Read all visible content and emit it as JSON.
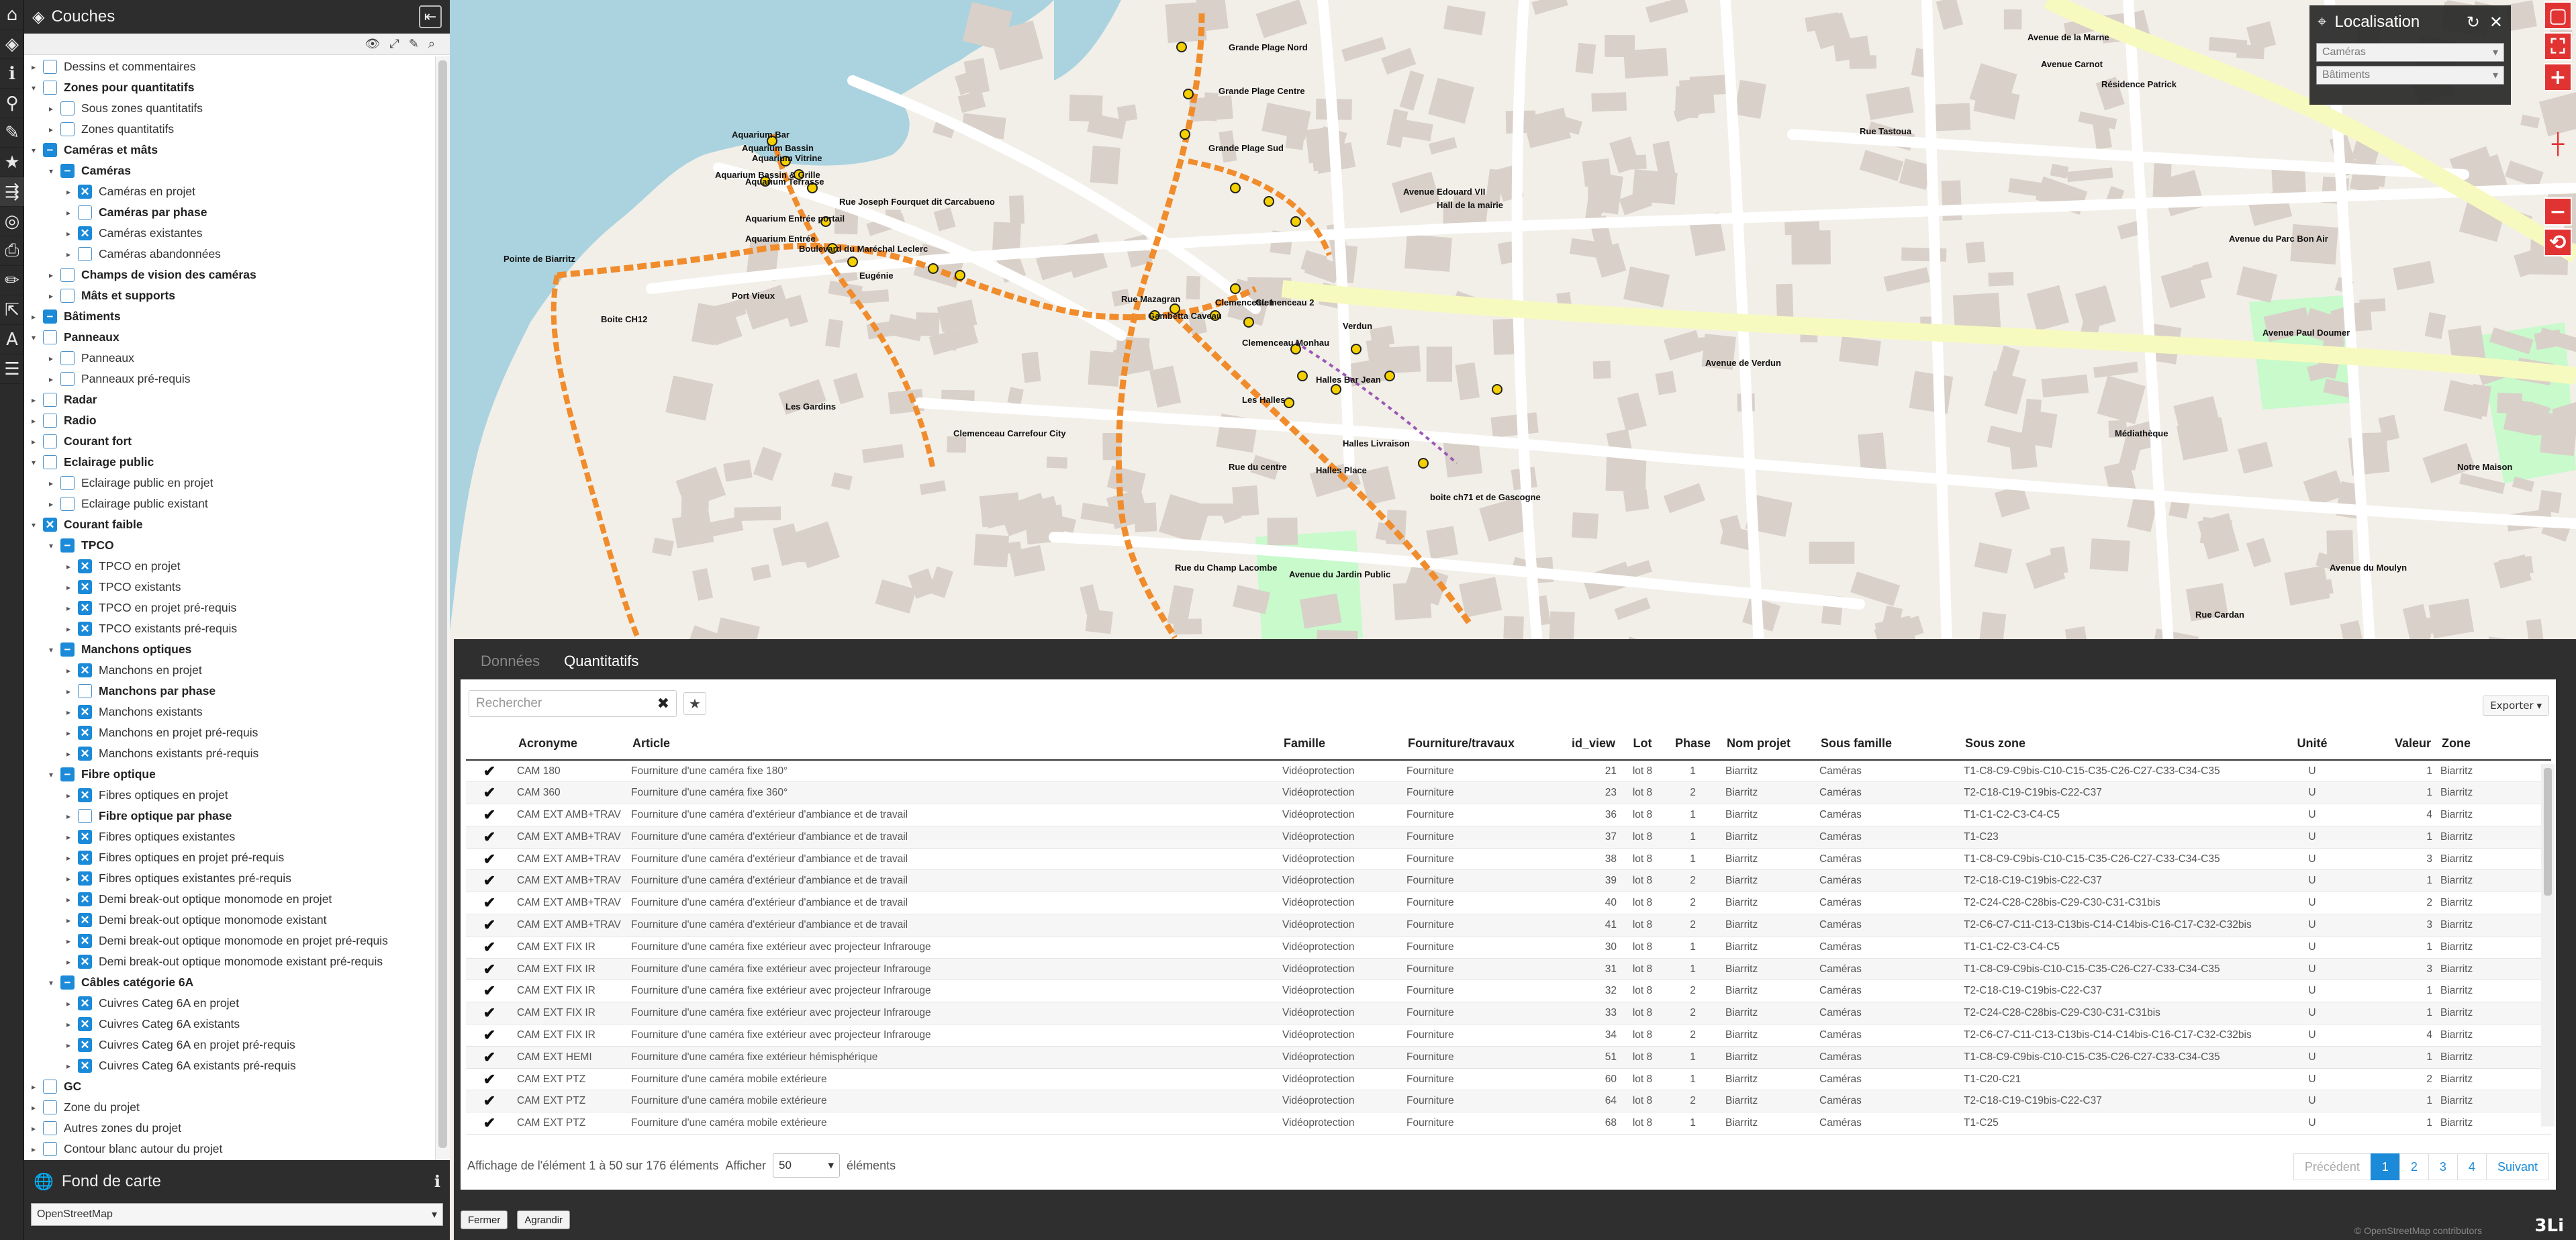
{
  "toolstrip": {
    "icons": [
      "layers-home-icon",
      "layers-icon",
      "info-icon",
      "measure-icon",
      "comment-icon",
      "favorite-star-icon",
      "road-icon",
      "target-icon",
      "print-icon",
      "draw-icon",
      "export-icon",
      "symbol-icon",
      "list-icon"
    ]
  },
  "layers_panel": {
    "title": "Couches",
    "items": [
      {
        "level": 0,
        "toggle": "▸",
        "check": "none",
        "label": "Dessins et commentaires",
        "bold": false
      },
      {
        "level": 0,
        "toggle": "▾",
        "check": "none",
        "label": "Zones pour quantitatifs",
        "bold": true
      },
      {
        "level": 1,
        "toggle": "▸",
        "check": "none",
        "label": "Sous zones quantitatifs",
        "bold": false
      },
      {
        "level": 1,
        "toggle": "▸",
        "check": "none",
        "label": "Zones quantitatifs",
        "bold": false
      },
      {
        "level": 0,
        "toggle": "▾",
        "check": "dash",
        "label": "Caméras et mâts",
        "bold": true
      },
      {
        "level": 1,
        "toggle": "▾",
        "check": "dash",
        "label": "Caméras",
        "bold": true
      },
      {
        "level": 2,
        "toggle": "▸",
        "check": "x",
        "label": "Caméras en projet",
        "bold": false
      },
      {
        "level": 2,
        "toggle": "▸",
        "check": "none",
        "label": "Caméras par phase",
        "bold": true
      },
      {
        "level": 2,
        "toggle": "▸",
        "check": "x",
        "label": "Caméras existantes",
        "bold": false
      },
      {
        "level": 2,
        "toggle": "▸",
        "check": "none",
        "label": "Caméras abandonnées",
        "bold": false
      },
      {
        "level": 1,
        "toggle": "▸",
        "check": "none",
        "label": "Champs de vision des caméras",
        "bold": true
      },
      {
        "level": 1,
        "toggle": "▸",
        "check": "none",
        "label": "Mâts et supports",
        "bold": true
      },
      {
        "level": 0,
        "toggle": "▸",
        "check": "dash",
        "label": "Bâtiments",
        "bold": true
      },
      {
        "level": 0,
        "toggle": "▾",
        "check": "none",
        "label": "Panneaux",
        "bold": true
      },
      {
        "level": 1,
        "toggle": "▸",
        "check": "none",
        "label": "Panneaux",
        "bold": false
      },
      {
        "level": 1,
        "toggle": "▸",
        "check": "none",
        "label": "Panneaux pré-requis",
        "bold": false
      },
      {
        "level": 0,
        "toggle": "▸",
        "check": "none",
        "label": "Radar",
        "bold": true
      },
      {
        "level": 0,
        "toggle": "▸",
        "check": "none",
        "label": "Radio",
        "bold": true
      },
      {
        "level": 0,
        "toggle": "▸",
        "check": "none",
        "label": "Courant fort",
        "bold": true
      },
      {
        "level": 0,
        "toggle": "▾",
        "check": "none",
        "label": "Eclairage public",
        "bold": true
      },
      {
        "level": 1,
        "toggle": "▸",
        "check": "none",
        "label": "Eclairage public en projet",
        "bold": false
      },
      {
        "level": 1,
        "toggle": "▸",
        "check": "none",
        "label": "Eclairage public existant",
        "bold": false
      },
      {
        "level": 0,
        "toggle": "▾",
        "check": "x",
        "label": "Courant faible",
        "bold": true
      },
      {
        "level": 1,
        "toggle": "▾",
        "check": "dash",
        "label": "TPCO",
        "bold": true
      },
      {
        "level": 2,
        "toggle": "▸",
        "check": "x",
        "label": "TPCO en projet",
        "bold": false
      },
      {
        "level": 2,
        "toggle": "▸",
        "check": "x",
        "label": "TPCO existants",
        "bold": false
      },
      {
        "level": 2,
        "toggle": "▸",
        "check": "x",
        "label": "TPCO en projet pré-requis",
        "bold": false
      },
      {
        "level": 2,
        "toggle": "▸",
        "check": "x",
        "label": "TPCO existants pré-requis",
        "bold": false
      },
      {
        "level": 1,
        "toggle": "▾",
        "check": "dash",
        "label": "Manchons optiques",
        "bold": true
      },
      {
        "level": 2,
        "toggle": "▸",
        "check": "x",
        "label": "Manchons en projet",
        "bold": false
      },
      {
        "level": 2,
        "toggle": "▸",
        "check": "none",
        "label": "Manchons par phase",
        "bold": true
      },
      {
        "level": 2,
        "toggle": "▸",
        "check": "x",
        "label": "Manchons existants",
        "bold": false
      },
      {
        "level": 2,
        "toggle": "▸",
        "check": "x",
        "label": "Manchons en projet pré-requis",
        "bold": false
      },
      {
        "level": 2,
        "toggle": "▸",
        "check": "x",
        "label": "Manchons existants pré-requis",
        "bold": false
      },
      {
        "level": 1,
        "toggle": "▾",
        "check": "dash",
        "label": "Fibre optique",
        "bold": true
      },
      {
        "level": 2,
        "toggle": "▸",
        "check": "x",
        "label": "Fibres optiques en projet",
        "bold": false
      },
      {
        "level": 2,
        "toggle": "▸",
        "check": "none",
        "label": "Fibre optique par phase",
        "bold": true
      },
      {
        "level": 2,
        "toggle": "▸",
        "check": "x",
        "label": "Fibres optiques existantes",
        "bold": false
      },
      {
        "level": 2,
        "toggle": "▸",
        "check": "x",
        "label": "Fibres optiques en projet pré-requis",
        "bold": false
      },
      {
        "level": 2,
        "toggle": "▸",
        "check": "x",
        "label": "Fibres optiques existantes pré-requis",
        "bold": false
      },
      {
        "level": 2,
        "toggle": "▸",
        "check": "x",
        "label": "Demi break-out optique monomode en projet",
        "bold": false
      },
      {
        "level": 2,
        "toggle": "▸",
        "check": "x",
        "label": "Demi break-out optique monomode existant",
        "bold": false
      },
      {
        "level": 2,
        "toggle": "▸",
        "check": "x",
        "label": "Demi break-out optique monomode en projet pré-requis",
        "bold": false
      },
      {
        "level": 2,
        "toggle": "▸",
        "check": "x",
        "label": "Demi break-out optique monomode existant pré-requis",
        "bold": false
      },
      {
        "level": 1,
        "toggle": "▾",
        "check": "dash",
        "label": "Câbles catégorie 6A",
        "bold": true
      },
      {
        "level": 2,
        "toggle": "▸",
        "check": "x",
        "label": "Cuivres Categ 6A en projet",
        "bold": false
      },
      {
        "level": 2,
        "toggle": "▸",
        "check": "x",
        "label": "Cuivres Categ 6A existants",
        "bold": false
      },
      {
        "level": 2,
        "toggle": "▸",
        "check": "x",
        "label": "Cuivres Categ 6A en projet pré-requis",
        "bold": false
      },
      {
        "level": 2,
        "toggle": "▸",
        "check": "x",
        "label": "Cuivres Categ 6A existants pré-requis",
        "bold": false
      },
      {
        "level": 0,
        "toggle": "▸",
        "check": "none",
        "label": "GC",
        "bold": true
      },
      {
        "level": 0,
        "toggle": "▸",
        "check": "none",
        "label": "Zone du projet",
        "bold": false
      },
      {
        "level": 0,
        "toggle": "▸",
        "check": "none",
        "label": "Autres zones du projet",
        "bold": false
      },
      {
        "level": 0,
        "toggle": "▸",
        "check": "none",
        "label": "Contour blanc autour du projet",
        "bold": false
      }
    ]
  },
  "basemap": {
    "title": "Fond de carte",
    "selected": "OpenStreetMap"
  },
  "localisation": {
    "title": "Localisation",
    "select1": "Caméras",
    "select2": "Bâtiments"
  },
  "map": {
    "labels": [
      "Grande Plage Nord",
      "Grande Plage Centre",
      "Grande Plage Sud",
      "Aquarium Bar",
      "Aquarium Bassin",
      "Aquarium Vitrine",
      "Aquarium Bassin & Grille",
      "Aquarium Terrasse",
      "Aquarium Entrée portail",
      "Aquarium Entrée",
      "Port Vieux",
      "Boite CH12",
      "Eugénie",
      "Gambetta Caveau",
      "Clemenceau 1",
      "Clemenceau 2",
      "Clemenceau Monhau",
      "Verdun",
      "Halles Bar Jean",
      "Les Halles",
      "Halles Livraison",
      "Halles Place",
      "Rue du centre",
      "Clemenceau Carrefour City",
      "Hall de la mairie",
      "Avenue de Verdun",
      "Avenue de la Marne",
      "Avenue Edouard VII",
      "Rue Mazagran",
      "Rue du Champ Lacombe",
      "Avenue du Jardin Public",
      "Avenue du Parc Bon Air",
      "Boulevard du Maréchal Leclerc",
      "Rue Joseph Fourquet dit Carcabueno",
      "Pointe de Biarritz",
      "Avenue Carnot",
      "Rue Cardan",
      "Avenue du Moulyn",
      "Rue Tastoua",
      "Avenue Paul Doumer",
      "Médiathèque",
      "Notre Maison",
      "Résidence Patrick",
      "Les Gardins",
      "boite ch71 et de Gascogne"
    ]
  },
  "panel": {
    "tabs": [
      {
        "label": "Données",
        "active": false
      },
      {
        "label": "Quantitatifs",
        "active": true
      }
    ],
    "search_placeholder": "Rechercher",
    "export_label": "Exporter",
    "columns": [
      "",
      "Acronyme",
      "Article",
      "Famille",
      "Fourniture/travaux",
      "id_view",
      "Lot",
      "Phase",
      "Nom projet",
      "Sous famille",
      "Sous zone",
      "Unité",
      "Valeur",
      "Zone"
    ],
    "rows": [
      [
        "✔",
        "CAM 180",
        "Fourniture d'une caméra fixe 180°",
        "Vidéoprotection",
        "Fourniture",
        "21",
        "lot 8",
        "1",
        "Biarritz",
        "Caméras",
        "T1-C8-C9-C9bis-C10-C15-C35-C26-C27-C33-C34-C35",
        "U",
        "1",
        "Biarritz"
      ],
      [
        "✔",
        "CAM 360",
        "Fourniture d'une caméra fixe 360°",
        "Vidéoprotection",
        "Fourniture",
        "23",
        "lot 8",
        "2",
        "Biarritz",
        "Caméras",
        "T2-C18-C19-C19bis-C22-C37",
        "U",
        "1",
        "Biarritz"
      ],
      [
        "✔",
        "CAM EXT AMB+TRAV",
        "Fourniture d'une caméra d'extérieur d'ambiance et de travail",
        "Vidéoprotection",
        "Fourniture",
        "36",
        "lot 8",
        "1",
        "Biarritz",
        "Caméras",
        "T1-C1-C2-C3-C4-C5",
        "U",
        "4",
        "Biarritz"
      ],
      [
        "✔",
        "CAM EXT AMB+TRAV",
        "Fourniture d'une caméra d'extérieur d'ambiance et de travail",
        "Vidéoprotection",
        "Fourniture",
        "37",
        "lot 8",
        "1",
        "Biarritz",
        "Caméras",
        "T1-C23",
        "U",
        "1",
        "Biarritz"
      ],
      [
        "✔",
        "CAM EXT AMB+TRAV",
        "Fourniture d'une caméra d'extérieur d'ambiance et de travail",
        "Vidéoprotection",
        "Fourniture",
        "38",
        "lot 8",
        "1",
        "Biarritz",
        "Caméras",
        "T1-C8-C9-C9bis-C10-C15-C35-C26-C27-C33-C34-C35",
        "U",
        "3",
        "Biarritz"
      ],
      [
        "✔",
        "CAM EXT AMB+TRAV",
        "Fourniture d'une caméra d'extérieur d'ambiance et de travail",
        "Vidéoprotection",
        "Fourniture",
        "39",
        "lot 8",
        "2",
        "Biarritz",
        "Caméras",
        "T2-C18-C19-C19bis-C22-C37",
        "U",
        "1",
        "Biarritz"
      ],
      [
        "✔",
        "CAM EXT AMB+TRAV",
        "Fourniture d'une caméra d'extérieur d'ambiance et de travail",
        "Vidéoprotection",
        "Fourniture",
        "40",
        "lot 8",
        "2",
        "Biarritz",
        "Caméras",
        "T2-C24-C28-C28bis-C29-C30-C31-C31bis",
        "U",
        "2",
        "Biarritz"
      ],
      [
        "✔",
        "CAM EXT AMB+TRAV",
        "Fourniture d'une caméra d'extérieur d'ambiance et de travail",
        "Vidéoprotection",
        "Fourniture",
        "41",
        "lot 8",
        "2",
        "Biarritz",
        "Caméras",
        "T2-C6-C7-C11-C13-C13bis-C14-C14bis-C16-C17-C32-C32bis",
        "U",
        "3",
        "Biarritz"
      ],
      [
        "✔",
        "CAM EXT FIX IR",
        "Fourniture d'une caméra fixe extérieur avec projecteur Infrarouge",
        "Vidéoprotection",
        "Fourniture",
        "30",
        "lot 8",
        "1",
        "Biarritz",
        "Caméras",
        "T1-C1-C2-C3-C4-C5",
        "U",
        "1",
        "Biarritz"
      ],
      [
        "✔",
        "CAM EXT FIX IR",
        "Fourniture d'une caméra fixe extérieur avec projecteur Infrarouge",
        "Vidéoprotection",
        "Fourniture",
        "31",
        "lot 8",
        "1",
        "Biarritz",
        "Caméras",
        "T1-C8-C9-C9bis-C10-C15-C35-C26-C27-C33-C34-C35",
        "U",
        "3",
        "Biarritz"
      ],
      [
        "✔",
        "CAM EXT FIX IR",
        "Fourniture d'une caméra fixe extérieur avec projecteur Infrarouge",
        "Vidéoprotection",
        "Fourniture",
        "32",
        "lot 8",
        "2",
        "Biarritz",
        "Caméras",
        "T2-C18-C19-C19bis-C22-C37",
        "U",
        "1",
        "Biarritz"
      ],
      [
        "✔",
        "CAM EXT FIX IR",
        "Fourniture d'une caméra fixe extérieur avec projecteur Infrarouge",
        "Vidéoprotection",
        "Fourniture",
        "33",
        "lot 8",
        "2",
        "Biarritz",
        "Caméras",
        "T2-C24-C28-C28bis-C29-C30-C31-C31bis",
        "U",
        "1",
        "Biarritz"
      ],
      [
        "✔",
        "CAM EXT FIX IR",
        "Fourniture d'une caméra fixe extérieur avec projecteur Infrarouge",
        "Vidéoprotection",
        "Fourniture",
        "34",
        "lot 8",
        "2",
        "Biarritz",
        "Caméras",
        "T2-C6-C7-C11-C13-C13bis-C14-C14bis-C16-C17-C32-C32bis",
        "U",
        "4",
        "Biarritz"
      ],
      [
        "✔",
        "CAM EXT HEMI",
        "Fourniture d'une caméra fixe extérieur hémisphérique",
        "Vidéoprotection",
        "Fourniture",
        "51",
        "lot 8",
        "1",
        "Biarritz",
        "Caméras",
        "T1-C8-C9-C9bis-C10-C15-C35-C26-C27-C33-C34-C35",
        "U",
        "1",
        "Biarritz"
      ],
      [
        "✔",
        "CAM EXT PTZ",
        "Fourniture d'une caméra mobile extérieure",
        "Vidéoprotection",
        "Fourniture",
        "60",
        "lot 8",
        "1",
        "Biarritz",
        "Caméras",
        "T1-C20-C21",
        "U",
        "2",
        "Biarritz"
      ],
      [
        "✔",
        "CAM EXT PTZ",
        "Fourniture d'une caméra mobile extérieure",
        "Vidéoprotection",
        "Fourniture",
        "64",
        "lot 8",
        "2",
        "Biarritz",
        "Caméras",
        "T2-C18-C19-C19bis-C22-C37",
        "U",
        "1",
        "Biarritz"
      ],
      [
        "✔",
        "CAM EXT PTZ",
        "Fourniture d'une caméra mobile extérieure",
        "Vidéoprotection",
        "Fourniture",
        "68",
        "lot 8",
        "1",
        "Biarritz",
        "Caméras",
        "T1-C25",
        "U",
        "1",
        "Biarritz"
      ]
    ],
    "info": "Affichage de l'élément 1 à 50 sur 176 éléments",
    "show_label": "Afficher",
    "page_length": "50",
    "elements_label": "éléments",
    "pager": {
      "prev": "Précédent",
      "pages": [
        "1",
        "2",
        "3",
        "4"
      ],
      "current": "1",
      "next": "Suivant"
    },
    "close_label": "Fermer",
    "enlarge_label": "Agrandir"
  },
  "attribution": "© OpenStreetMap contributors",
  "logo": "3Li",
  "colors": {
    "accent": "#1b8ad8",
    "dark_panel": "#2d2d2d",
    "map_button": "#e23333",
    "fiber_route": "#f08c2c",
    "building": "#d9d0c9",
    "land": "#f2efe9",
    "water": "#aad3df",
    "park": "#c8facc"
  }
}
